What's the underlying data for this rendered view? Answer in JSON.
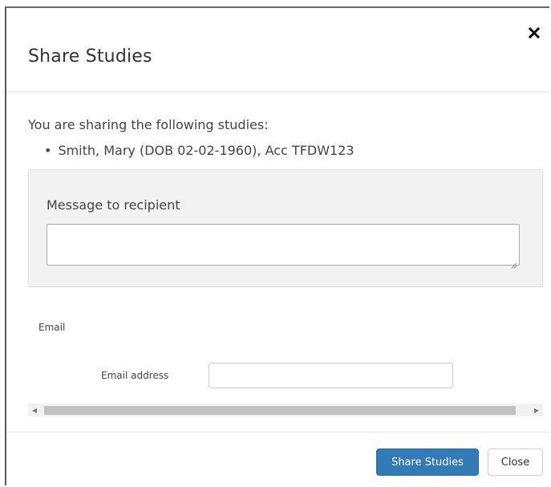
{
  "dialog": {
    "title": "Share Studies",
    "close_icon": "close-icon"
  },
  "studies": {
    "intro": "You are sharing the following studies:",
    "items": [
      "Smith, Mary (DOB 02-02-1960), Acc TFDW123"
    ]
  },
  "message": {
    "label": "Message to recipient",
    "value": ""
  },
  "email": {
    "section_label": "Email",
    "field_label": "Email address",
    "value": ""
  },
  "footer": {
    "share_label": "Share Studies",
    "close_label": "Close"
  },
  "colors": {
    "primary": "#337ab7",
    "panel_bg": "#f2f2f2"
  }
}
